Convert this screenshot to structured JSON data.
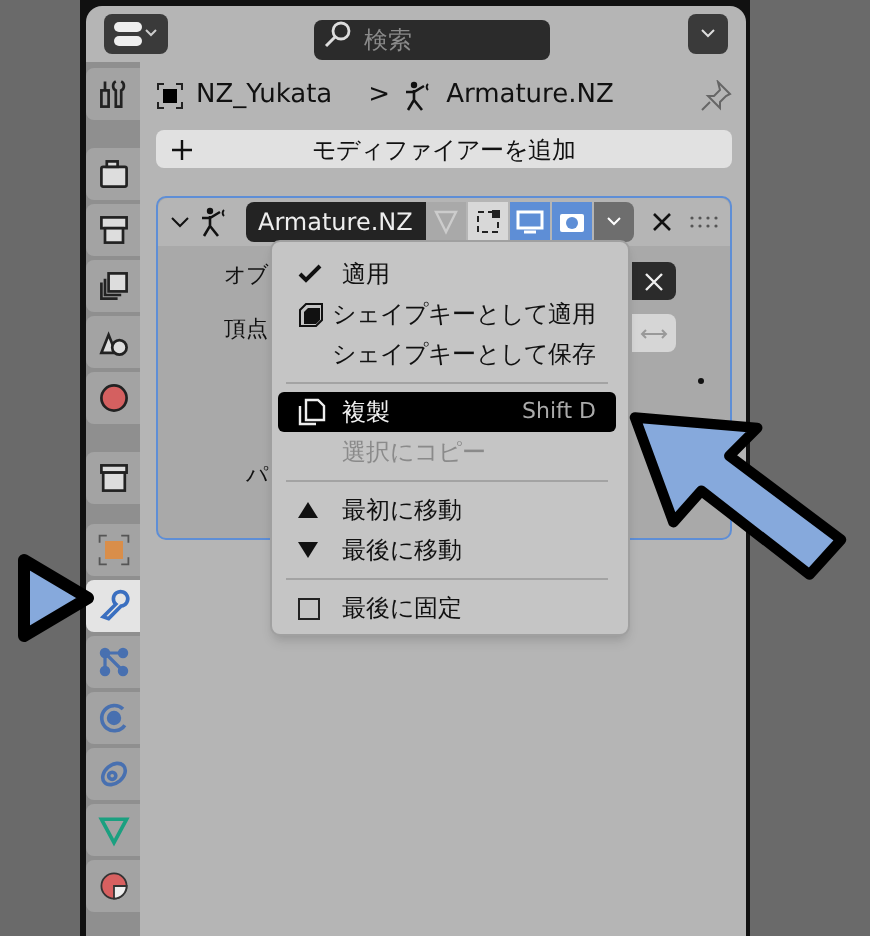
{
  "header": {
    "search": {
      "placeholder": "検索"
    }
  },
  "tabs": [
    {
      "kind": "tool",
      "selected": false
    },
    {
      "kind": "render",
      "selected": false
    },
    {
      "kind": "output",
      "selected": false
    },
    {
      "kind": "view_layer",
      "selected": false
    },
    {
      "kind": "scene",
      "selected": false
    },
    {
      "kind": "world",
      "selected": false
    },
    {
      "kind": "collection",
      "selected": false
    },
    {
      "kind": "object",
      "selected": false
    },
    {
      "kind": "modifiers",
      "selected": true
    },
    {
      "kind": "particles",
      "selected": false
    },
    {
      "kind": "physics",
      "selected": false
    },
    {
      "kind": "constraints",
      "selected": false
    },
    {
      "kind": "data",
      "selected": false
    },
    {
      "kind": "material",
      "selected": false
    }
  ],
  "breadcrumb": {
    "object": "NZ_Yukata",
    "separator": ">",
    "armature": "Armature.NZ"
  },
  "add_modifier": {
    "label": "モディファイアーを追加"
  },
  "modifier": {
    "expanded": true,
    "name": "Armature.NZ",
    "toggles": [
      {
        "kind": "edit_cage",
        "on": false
      },
      {
        "kind": "edit_mode",
        "on": false
      },
      {
        "kind": "viewport",
        "on": true
      },
      {
        "kind": "render",
        "on": true
      }
    ],
    "fields": [
      "オブ",
      "頂点",
      "パ"
    ]
  },
  "menu": {
    "items": [
      {
        "kind": "check",
        "label": "適用",
        "selected": false,
        "disabled": false
      },
      {
        "kind": "shape_key",
        "label": "シェイプキーとして適用",
        "selected": false,
        "disabled": false
      },
      {
        "kind": "plain",
        "label": "シェイプキーとして保存",
        "selected": false,
        "disabled": false
      },
      {
        "kind": "separator"
      },
      {
        "kind": "duplicate",
        "label": "複製",
        "shortcut": "Shift D",
        "selected": true,
        "disabled": false
      },
      {
        "kind": "plain",
        "label": "選択にコピー",
        "selected": false,
        "disabled": true
      },
      {
        "kind": "separator"
      },
      {
        "kind": "move_up",
        "label": "最初に移動",
        "selected": false,
        "disabled": false
      },
      {
        "kind": "move_down",
        "label": "最後に移動",
        "selected": false,
        "disabled": false
      },
      {
        "kind": "separator"
      },
      {
        "kind": "checkbox",
        "label": "最後に固定",
        "selected": false,
        "disabled": false
      }
    ]
  }
}
